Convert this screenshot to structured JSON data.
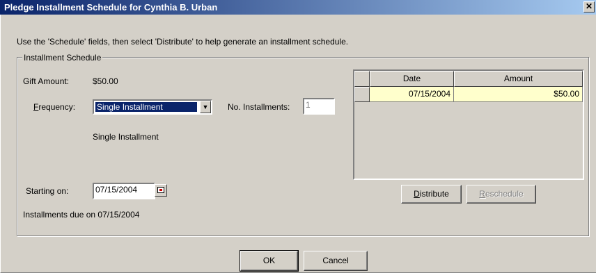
{
  "window": {
    "title": "Pledge Installment Schedule for Cynthia B. Urban",
    "close_glyph": "✕"
  },
  "instructions": "Use the 'Schedule' fields, then select 'Distribute' to help generate an installment schedule.",
  "group": {
    "label": "Installment Schedule",
    "gift_amount_label": "Gift Amount:",
    "gift_amount_value": "$50.00",
    "frequency_label_first": "F",
    "frequency_label_rest": "requency:",
    "frequency_value": "Single Installment",
    "num_installments_label": "No. Installments:",
    "num_installments_value": "1",
    "frequency_description": "Single Installment",
    "starting_on_label": "Starting on:",
    "starting_on_value": "07/15/2004",
    "installments_due": "Installments due on 07/15/2004"
  },
  "grid": {
    "columns": [
      "Date",
      "Amount"
    ],
    "rows": [
      {
        "date": "07/15/2004",
        "amount": "$50.00"
      }
    ]
  },
  "buttons": {
    "distribute_first": "D",
    "distribute_rest": "istribute",
    "reschedule_first": "R",
    "reschedule_rest": "eschedule",
    "ok": "OK",
    "cancel": "Cancel"
  },
  "colors": {
    "title_start": "#0a246a",
    "title_end": "#a6caf0",
    "face": "#d4d0c8",
    "grid_cell": "#ffffcc"
  }
}
